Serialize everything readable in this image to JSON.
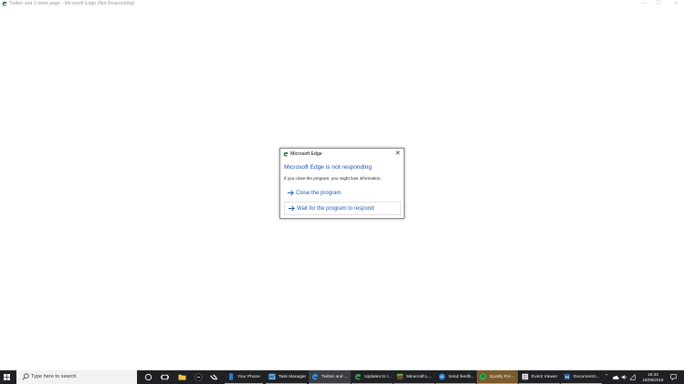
{
  "window": {
    "title": "Twitter and 1 more page - Microsoft Edge (Not Responding)",
    "controls": {
      "minimize": "—",
      "maximize": "☐",
      "close": "✕"
    }
  },
  "dialog": {
    "title": "Microsoft Edge",
    "heading": "Microsoft Edge is not responding",
    "message": "If you close the program, you might lose information.",
    "options": [
      {
        "label": "Close the program"
      },
      {
        "label": "Wait for the program to respond"
      }
    ],
    "close_glyph": "✕"
  },
  "taskbar": {
    "search_placeholder": "Type here to search",
    "apps": [
      {
        "label": "Your Phone",
        "icon": "your-phone-icon"
      },
      {
        "label": "Task Manager",
        "icon": "task-manager-icon"
      },
      {
        "label": "Twitter and ...",
        "icon": "edge-icon"
      },
      {
        "label": "Updates to t...",
        "icon": "edge-icon"
      },
      {
        "label": "Minecraft L...",
        "icon": "minecraft-icon"
      },
      {
        "label": "Send feedb...",
        "icon": "feedback-icon"
      },
      {
        "label": "Spotify Pre...",
        "icon": "spotify-icon"
      },
      {
        "label": "Event Viewer",
        "icon": "event-viewer-icon"
      },
      {
        "label": "Document1...",
        "icon": "word-icon"
      }
    ],
    "clock": {
      "time": "18:33",
      "date": "18/09/2019"
    }
  },
  "colors": {
    "taskbar": "#1f2124",
    "accent_link": "#1f5fb4",
    "heading": "#1f4fb4"
  }
}
